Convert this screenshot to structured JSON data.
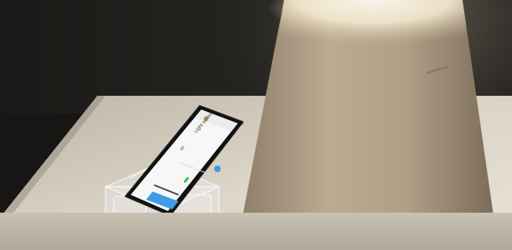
{
  "phone_screen": {
    "title": "Light sensor",
    "value": "40",
    "button_label": "",
    "status_items": [
      "",
      "",
      ""
    ]
  },
  "colors": {
    "screen_bg": "#f7f7f7",
    "accent": "#3d9be9",
    "toggle": "#2cc35a",
    "lamp_shade": "#a89882",
    "table": "#d6d0c4"
  },
  "icons": {
    "app_icon": "light-bulb-icon"
  }
}
